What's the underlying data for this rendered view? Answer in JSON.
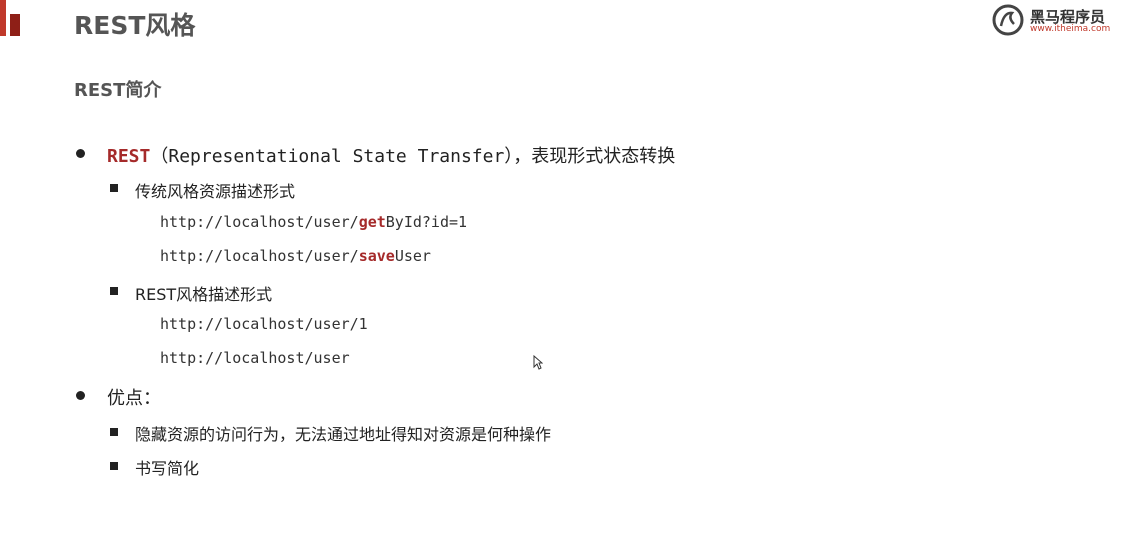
{
  "header": {
    "title": "REST风格",
    "subtitle": "REST简介"
  },
  "logo": {
    "name": "黑马程序员",
    "url": "www.itheima.com"
  },
  "content": {
    "rest_keyword": "REST",
    "rest_desc": "（Representational State Transfer），表现形式状态转换",
    "traditional_label": "传统风格资源描述形式",
    "traditional_urls": [
      {
        "prefix": "http://localhost/user/",
        "highlight": "get",
        "suffix": "ById?id=1"
      },
      {
        "prefix": "http://localhost/user/",
        "highlight": "save",
        "suffix": "User"
      }
    ],
    "rest_label": "REST风格描述形式",
    "rest_urls": [
      "http://localhost/user/1",
      "http://localhost/user"
    ],
    "advantages_label": "优点：",
    "advantages": [
      "隐藏资源的访问行为，无法通过地址得知对资源是何种操作",
      "书写简化"
    ]
  },
  "colors": {
    "accent": "#a52a2a",
    "title": "#555555"
  }
}
